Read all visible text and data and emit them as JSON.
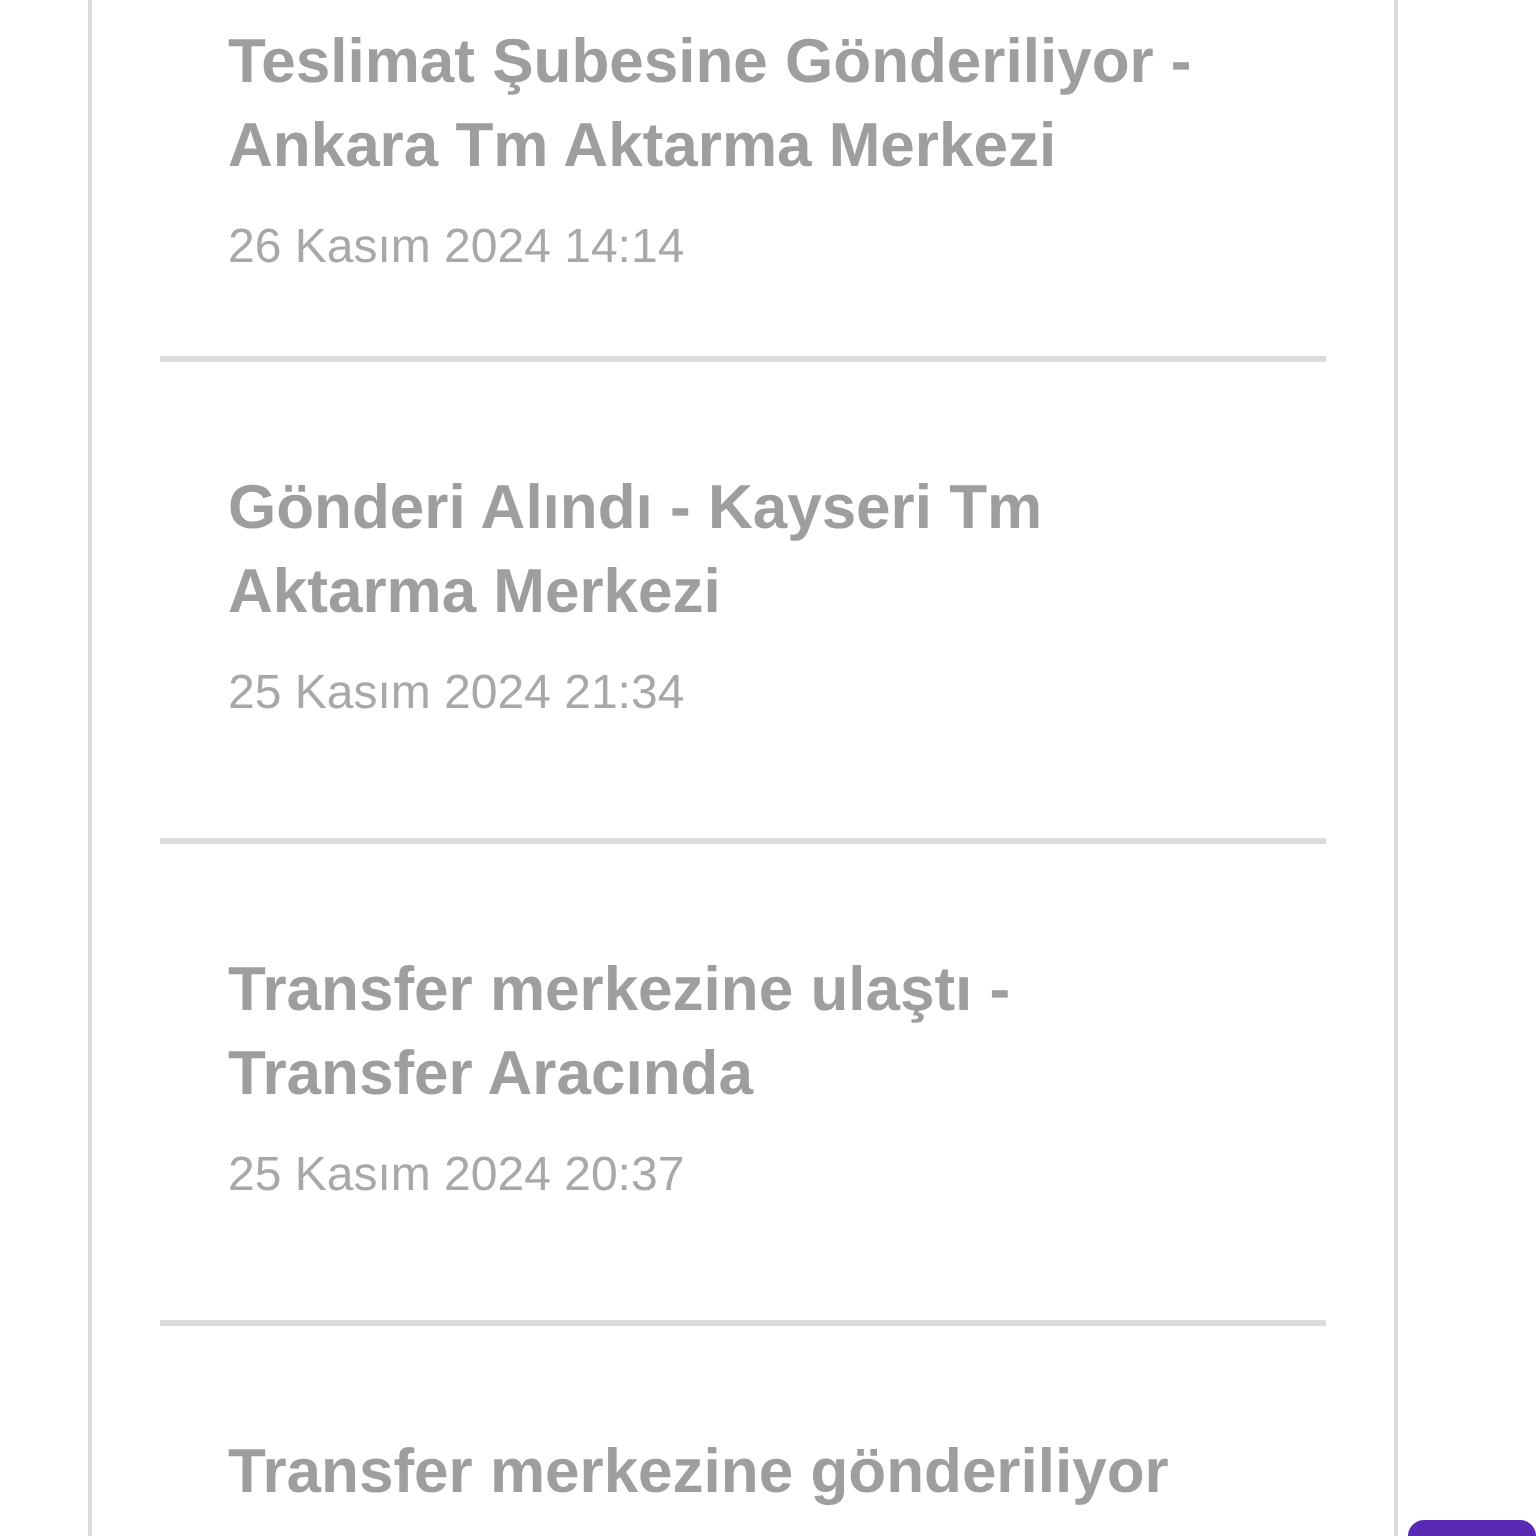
{
  "events": [
    {
      "title": "Teslimat Şubesine Gönderiliyor - Ankara Tm Aktarma Merkezi",
      "date": "26 Kasım 2024 14:14"
    },
    {
      "title": "Gönderi Alındı - Kayseri Tm Aktarma Merkezi",
      "date": "25 Kasım 2024 21:34"
    },
    {
      "title": "Transfer merkezine ulaştı - Transfer Aracında",
      "date": "25 Kasım 2024 20:37"
    },
    {
      "title": "Transfer merkezine gönderiliyor"
    }
  ]
}
